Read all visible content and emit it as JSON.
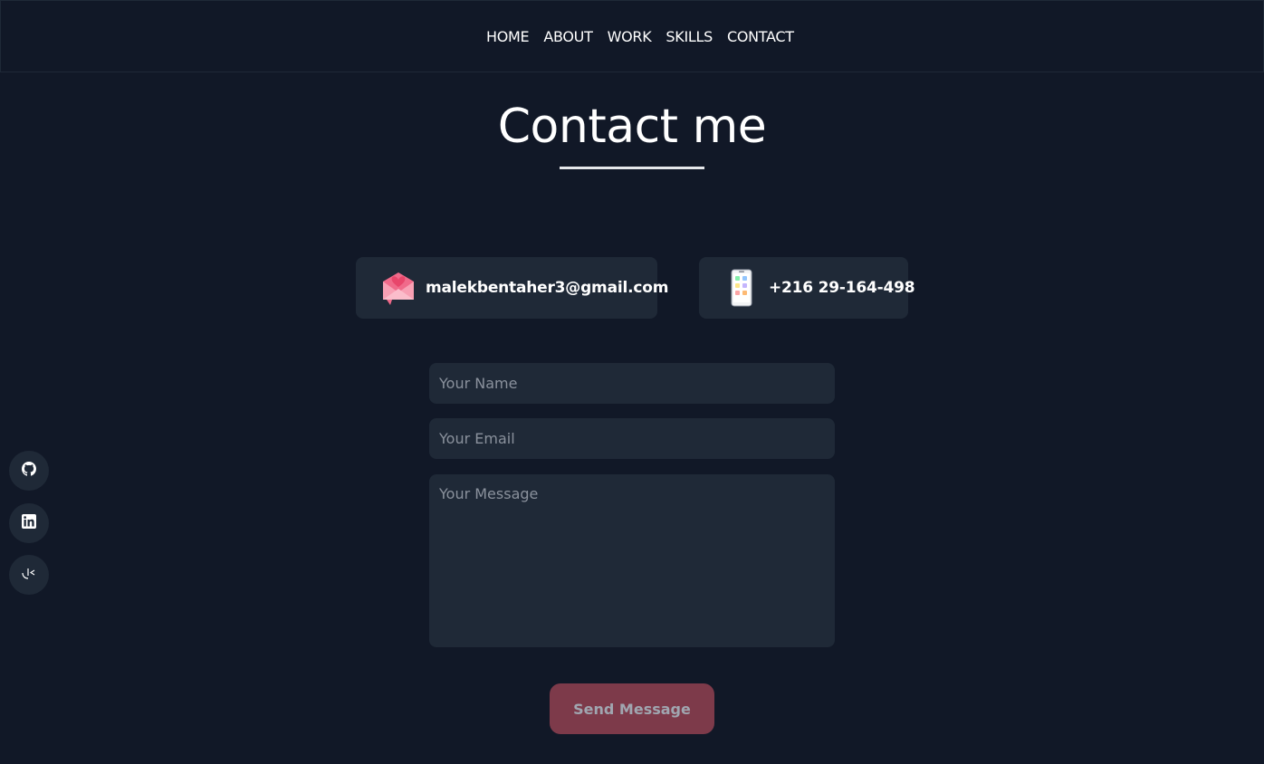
{
  "nav": {
    "items": [
      {
        "label": "HOME"
      },
      {
        "label": "ABOUT"
      },
      {
        "label": "WORK"
      },
      {
        "label": "SKILLS"
      },
      {
        "label": "CONTACT"
      }
    ]
  },
  "page": {
    "title": "Contact me"
  },
  "contact": {
    "email": "malekbentaher3@gmail.com",
    "email_icon": "envelope-heart-icon",
    "phone": "+216 29-164-498",
    "phone_icon": "smartphone-icon"
  },
  "form": {
    "name_placeholder": "Your Name",
    "email_placeholder": "Your Email",
    "message_placeholder": "Your Message",
    "name_value": "",
    "email_value": "",
    "message_value": "",
    "send_label": "Send Message"
  },
  "social": {
    "items": [
      {
        "icon": "github-icon"
      },
      {
        "icon": "linkedin-icon"
      },
      {
        "icon": "malt-icon"
      }
    ]
  },
  "colors": {
    "background": "#111827",
    "surface": "#1f2937",
    "button": "#7d3a4a",
    "text": "#ffffff",
    "placeholder": "#8a919c"
  }
}
